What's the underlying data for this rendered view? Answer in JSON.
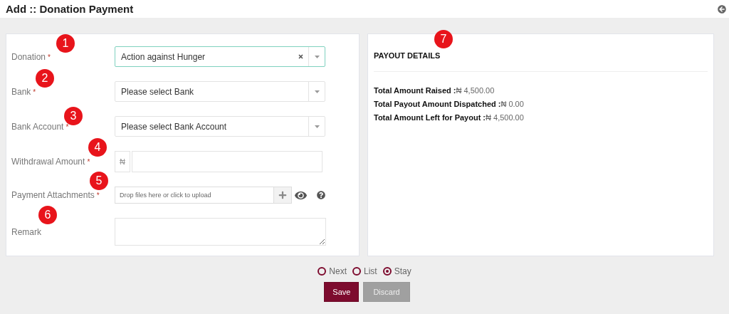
{
  "header": {
    "title": "Add :: Donation Payment"
  },
  "form": {
    "fields": [
      {
        "kind": "select",
        "label": "Donation",
        "required_mark": "*",
        "value": "Action against Hunger",
        "clearable": true,
        "focused": true
      },
      {
        "kind": "select",
        "label": "Bank",
        "required_mark": "*",
        "placeholder": "Please select Bank",
        "clearable": false,
        "focused": false
      },
      {
        "kind": "select",
        "label": "Bank Account",
        "required_mark": "*",
        "placeholder": "Please select Bank Account",
        "clearable": false,
        "focused": false
      },
      {
        "kind": "currency",
        "label": "Withdrawal Amount",
        "required_mark": "*",
        "prefix": "₦"
      },
      {
        "kind": "upload",
        "label": "Payment Attachments",
        "required_mark": "*",
        "placeholder": "Drop files here or click to upload"
      },
      {
        "kind": "textarea",
        "label": "Remark"
      }
    ]
  },
  "payout": {
    "title": "PAYOUT DETAILS",
    "rows": [
      {
        "label": "Total Amount Raised :",
        "value": "₦ 4,500.00"
      },
      {
        "label": "Total Payout Amount Dispatched :",
        "value": "₦ 0.00"
      },
      {
        "label": "Total Amount Left for Payout :",
        "value": "₦ 4,500.00"
      }
    ]
  },
  "after_save": [
    {
      "label": "Next",
      "selected": false
    },
    {
      "label": "List",
      "selected": false
    },
    {
      "label": "Stay",
      "selected": true
    }
  ],
  "buttons": [
    {
      "label": "Save",
      "kind": "primary"
    },
    {
      "label": "Discard",
      "kind": "secondary"
    }
  ],
  "markers": [
    "1",
    "2",
    "3",
    "4",
    "5",
    "6",
    "7"
  ]
}
